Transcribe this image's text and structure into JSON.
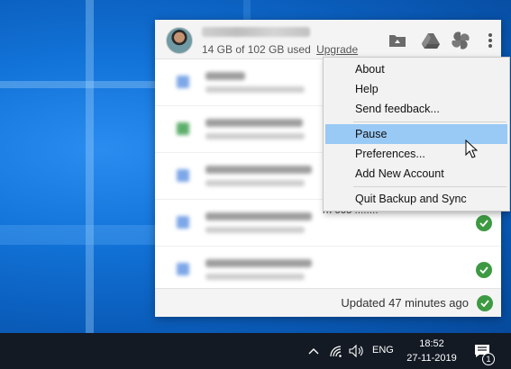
{
  "header": {
    "storage_text": "14 GB of 102 GB used",
    "upgrade_label": "Upgrade",
    "icons": [
      "open-folder-icon",
      "google-drive-icon",
      "google-photos-icon",
      "more-vert-icon"
    ]
  },
  "files": {
    "partial_text": "rn 668 ........",
    "sync_icon": "synced-check-icon"
  },
  "menu": {
    "items": [
      {
        "label": "About"
      },
      {
        "label": "Help"
      },
      {
        "label": "Send feedback..."
      },
      {
        "label": "Pause"
      },
      {
        "label": "Preferences..."
      },
      {
        "label": "Add New Account"
      },
      {
        "label": "Quit Backup and Sync"
      }
    ],
    "highlighted": "Pause"
  },
  "footer": {
    "status": "Updated 47 minutes ago"
  },
  "taskbar": {
    "language": "ENG",
    "time": "18:52",
    "date": "27-11-2019",
    "notification_count": "1",
    "tray_icons": [
      "show-hidden-icons-chevron",
      "wifi-icon",
      "speaker-icon",
      "action-center-icon"
    ]
  },
  "colors": {
    "accent_check": "#3d9a42",
    "menu_highlight": "#99c9f5",
    "taskbar": "#131a24",
    "wallpaper": "#1273d8"
  }
}
